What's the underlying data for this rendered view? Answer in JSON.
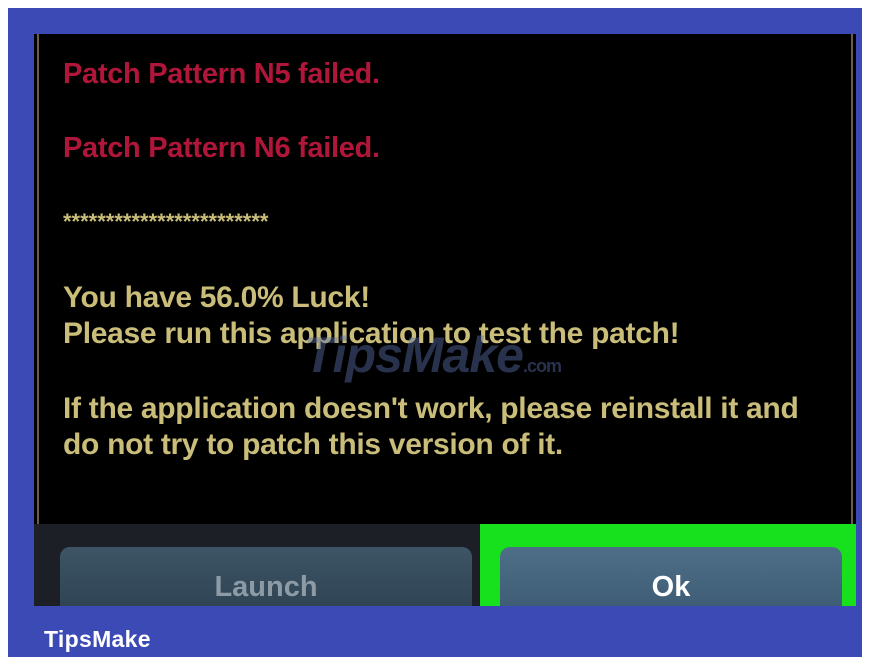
{
  "dialog": {
    "lines": {
      "error_n5": "Patch Pattern N5 failed.",
      "error_n6": "Patch Pattern N6 failed.",
      "separator": "************************",
      "luck": "You have 56.0% Luck!",
      "run_app": "Please run this application to test the patch!",
      "warning_1": "If the application doesn't work, please reinstall it and",
      "warning_2": "do not try to patch this version of it."
    },
    "buttons": {
      "launch_label": "Launch",
      "ok_label": "Ok"
    }
  },
  "watermark": {
    "text": "TipsMake",
    "tld": ".com"
  },
  "footer": {
    "brand": "TipsMake"
  },
  "colors": {
    "frame": "#3c4ab5",
    "error_text": "#b0163a",
    "info_text": "#c9bd79",
    "highlight": "#16e11c"
  }
}
